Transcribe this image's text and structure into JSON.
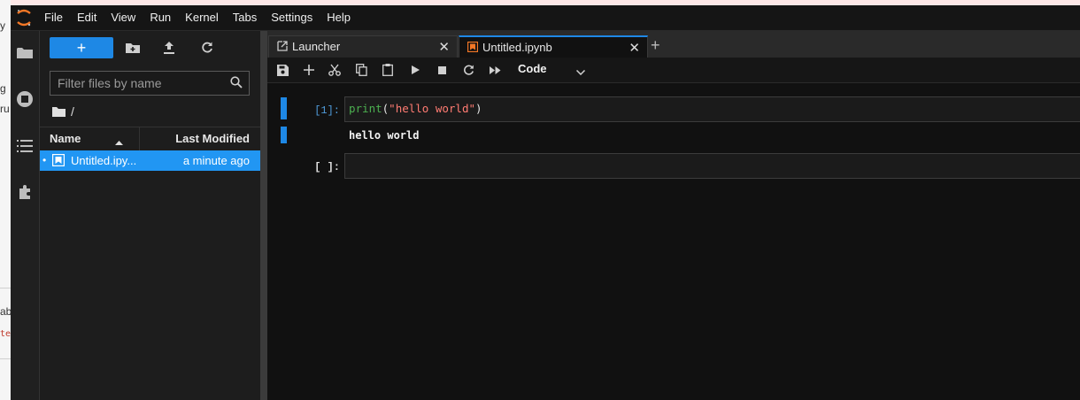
{
  "bg_fragments": [
    "y",
    "g",
    "ru",
    "ab",
    "te"
  ],
  "menu": [
    "File",
    "Edit",
    "View",
    "Run",
    "Kernel",
    "Tabs",
    "Settings",
    "Help"
  ],
  "sidebar_icons": [
    "folder-icon",
    "running-icon",
    "toc-icon",
    "extension-icon"
  ],
  "filebrowser": {
    "new_label": "+",
    "filter_placeholder": "Filter files by name",
    "breadcrumb": "/",
    "col_name": "Name",
    "col_modified": "Last Modified",
    "files": [
      {
        "name": "Untitled.ipy...",
        "modified": "a minute ago",
        "dot": "•"
      }
    ]
  },
  "tabs": [
    {
      "label": "Launcher",
      "active": false
    },
    {
      "label": "Untitled.ipynb",
      "active": true
    }
  ],
  "add_tab": "+",
  "toolbar": {
    "cell_type": "Code"
  },
  "cells": [
    {
      "prompt": "[1]:",
      "code_fn": "print",
      "code_open": "(",
      "code_str": "\"hello world\"",
      "code_close": ")",
      "output": "hello world"
    },
    {
      "prompt": "[ ]:",
      "code": ""
    }
  ],
  "colors": {
    "accent": "#1e88e5",
    "selected_row": "#2196f3",
    "code_fn": "#4caf50",
    "code_str": "#ff7b72",
    "prompt_in": "#4f9bd9"
  }
}
